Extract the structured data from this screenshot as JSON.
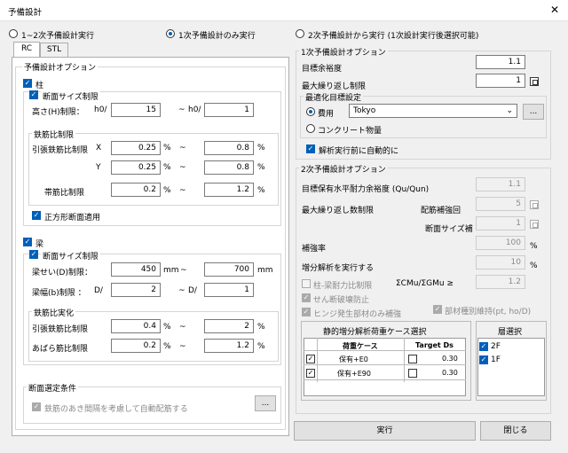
{
  "window": {
    "title": "予備設計"
  },
  "run_modes": {
    "mode1": "1~2次予備設計実行",
    "mode2": "1次予備設計のみ実行",
    "mode3": "2次予備設計から実行 (1次設計実行後選択可能)"
  },
  "tabs": [
    "RC",
    "STL"
  ],
  "left": {
    "group_title": "予備設計オプション",
    "column": {
      "label": "柱",
      "size_limit_label": "断面サイズ制限",
      "height_label": "高さ(H)制限：",
      "h0_label": "h0/",
      "h0_value": "15",
      "tilde": "~",
      "h0_label2": "h0/",
      "h0_value2": "1",
      "ratio_group": "鉄筋比制限",
      "tension_label": "引張鉄筋比制限",
      "x_label": "X",
      "y_label": "Y",
      "pct": "%",
      "x_min": "0.25",
      "x_max": "0.8",
      "y_min": "0.25",
      "y_max": "0.8",
      "hoop_label": "帯筋比制限",
      "hoop_min": "0.2",
      "hoop_max": "1.2",
      "square_label": "正方形断面適用"
    },
    "beam": {
      "label": "梁",
      "size_limit_label": "断面サイズ制限",
      "depth_label": "梁せい(D)制限：",
      "depth_min": "450",
      "depth_max": "700",
      "mm": "mm",
      "width_label": "梁幅(b)制限 ：",
      "d_label": "D/",
      "width_min": "2",
      "width_max": "1",
      "ratio_group": "鉄筋比実化",
      "tension_label": "引張鉄筋比制限",
      "tension_min": "0.4",
      "tension_max": "2",
      "stirrup_label": "あばら筋比制限",
      "stirrup_min": "0.2",
      "stirrup_max": "1.2"
    },
    "section_group": "断面選定条件",
    "auto_rebar_label": "鉄筋のあき間隔を考慮して自動配筋する",
    "ellipsis": "..."
  },
  "right": {
    "opt1_title": "1次予備設計オプション",
    "target_margin_label": "目標余裕度",
    "target_margin": "1.1",
    "max_iter_label": "最大繰り返し制限",
    "max_iter": "1",
    "opt_target_label": "最適化目標設定",
    "cost_label": "費用",
    "city": "Tokyo",
    "concrete_label": "コンクリート物量",
    "auto_analysis_label": "解析実行前に自動的に",
    "opt2_title": "2次予備設計オプション",
    "target_ratio_label": "目標保有水平耐力余裕度 (Qu/Qun)",
    "target_ratio": "1.1",
    "max_iter2_label": "最大繰り返し数制限",
    "rebar_adj_label": "配筋補強回",
    "rebar_adj": "5",
    "section_adj_label": "断面サイズ補",
    "section_adj": "1",
    "reinforce_label": "補強率",
    "reinforce": "100",
    "incr_label": "増分解析を実行する",
    "incr": "10",
    "col_beam_label": "柱-梁耐力比制限",
    "col_beam_formula": "ΣCMu/ΣGMu ≥",
    "col_beam_value": "1.2",
    "shear_label": "せん断破壊防止",
    "hinge_label": "ヒンジ発生部材のみ補強",
    "member_label": "部材種別維持(pt, ho/D)",
    "load_case_title": "静的増分解析荷重ケース選択",
    "load_header": "荷重ケース",
    "target_header": "Target Ds",
    "load_cases": [
      {
        "name": "保有+E0",
        "ds": "0.30"
      },
      {
        "name": "保有+E90",
        "ds": "0.30"
      }
    ],
    "story_title": "層選択",
    "stories": [
      "2F",
      "1F"
    ],
    "pct": "%"
  },
  "footer": {
    "run": "実行",
    "close": "閉じる"
  }
}
